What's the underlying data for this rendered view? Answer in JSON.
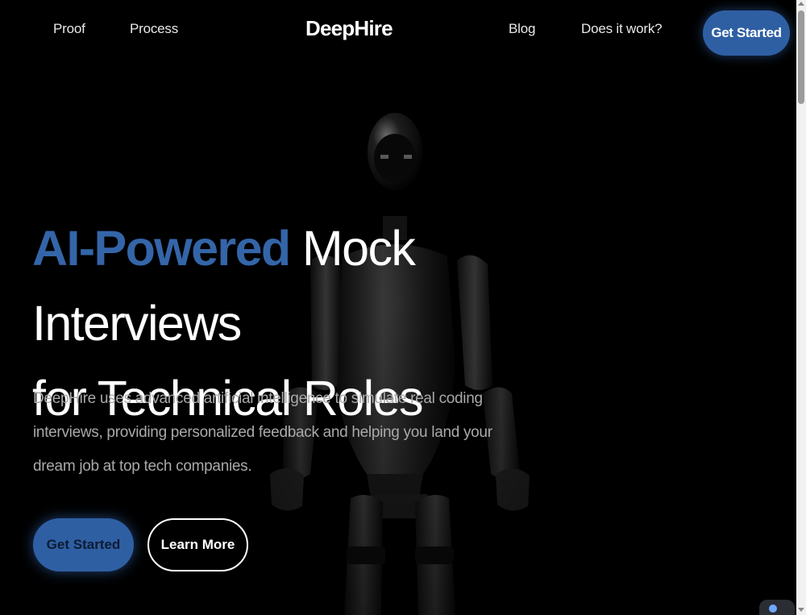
{
  "nav": {
    "links_left": [
      "Proof",
      "Process"
    ],
    "logo": "DeepHire",
    "links_right": [
      "Blog",
      "Does it work?"
    ],
    "cta": "Get Started"
  },
  "hero": {
    "title_accent": "AI-Powered",
    "title_rest_1": " Mock Interviews",
    "title_line_2": "for Technical Roles",
    "description": "DeepHire uses advanced artificial intelligence to simulate real coding interviews, providing personalized feedback and helping you land your dream job at top tech companies.",
    "primary_button": "Get Started",
    "secondary_button": "Learn More"
  },
  "colors": {
    "accent": "#2f5fa3",
    "background": "#000000",
    "text": "#ffffff",
    "muted_text": "#a9a9a9"
  },
  "icons": [
    "robot-illustration"
  ]
}
